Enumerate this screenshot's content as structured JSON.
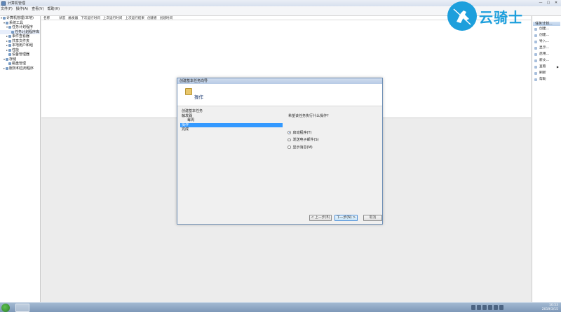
{
  "window": {
    "title": "计算机管理",
    "controls": [
      "—",
      "▢",
      "✕"
    ]
  },
  "menu": {
    "items": [
      "文件(F)",
      "操作(A)",
      "查看(V)",
      "帮助(H)"
    ]
  },
  "tree": {
    "items": [
      {
        "label": "计算机管理(本地)",
        "level": 0,
        "expander": "▾"
      },
      {
        "label": "系统工具",
        "level": 1,
        "expander": "▾"
      },
      {
        "label": "任务计划程序",
        "level": 2,
        "expander": "▾"
      },
      {
        "label": "任务计划程序库",
        "level": 3,
        "expander": ""
      },
      {
        "label": "事件查看器",
        "level": 2,
        "expander": "▸"
      },
      {
        "label": "共享文件夹",
        "level": 2,
        "expander": "▸"
      },
      {
        "label": "本地用户和组",
        "level": 2,
        "expander": "▸"
      },
      {
        "label": "性能",
        "level": 2,
        "expander": "▸"
      },
      {
        "label": "设备管理器",
        "level": 2,
        "expander": ""
      },
      {
        "label": "存储",
        "level": 1,
        "expander": "▾"
      },
      {
        "label": "磁盘管理",
        "level": 2,
        "expander": ""
      },
      {
        "label": "服务和应用程序",
        "level": 1,
        "expander": "▸"
      }
    ]
  },
  "list": {
    "columns": [
      "名称",
      "状态",
      "触发器",
      "下次运行时间",
      "上次运行时间",
      "上次运行结果",
      "创建者",
      "创建时间"
    ]
  },
  "actions": {
    "header": "任务计划...",
    "items": [
      {
        "label": "创建...",
        "arrow": ""
      },
      {
        "label": "创建...",
        "arrow": ""
      },
      {
        "label": "导入...",
        "arrow": ""
      },
      {
        "label": "显示...",
        "arrow": ""
      },
      {
        "label": "启用...",
        "arrow": ""
      },
      {
        "label": "新文...",
        "arrow": ""
      },
      {
        "label": "查看",
        "arrow": "▶"
      },
      {
        "label": "刷新",
        "arrow": ""
      },
      {
        "label": "帮助",
        "arrow": ""
      }
    ]
  },
  "logo": {
    "text": "云骑士"
  },
  "dialog": {
    "title": "创建基本任务向导",
    "header_title": "操作",
    "steps": [
      {
        "label": "创建基本任务",
        "sub": false,
        "active": false
      },
      {
        "label": "触发器",
        "sub": false,
        "active": false
      },
      {
        "label": "每周",
        "sub": true,
        "active": false
      },
      {
        "label": "操作",
        "sub": false,
        "active": true
      },
      {
        "label": "完成",
        "sub": false,
        "active": false
      }
    ],
    "question": "希望该任务执行什么操作?",
    "options": [
      {
        "label": "启动程序(T)",
        "selected": true
      },
      {
        "label": "发送电子邮件(S)",
        "selected": false
      },
      {
        "label": "显示消息(M)",
        "selected": false
      }
    ],
    "buttons": {
      "prev": "< 上一步(B)",
      "next": "下一步(N) >",
      "cancel": "取消"
    }
  },
  "taskbar": {
    "time": "10:53",
    "date": "2019/3/15"
  }
}
